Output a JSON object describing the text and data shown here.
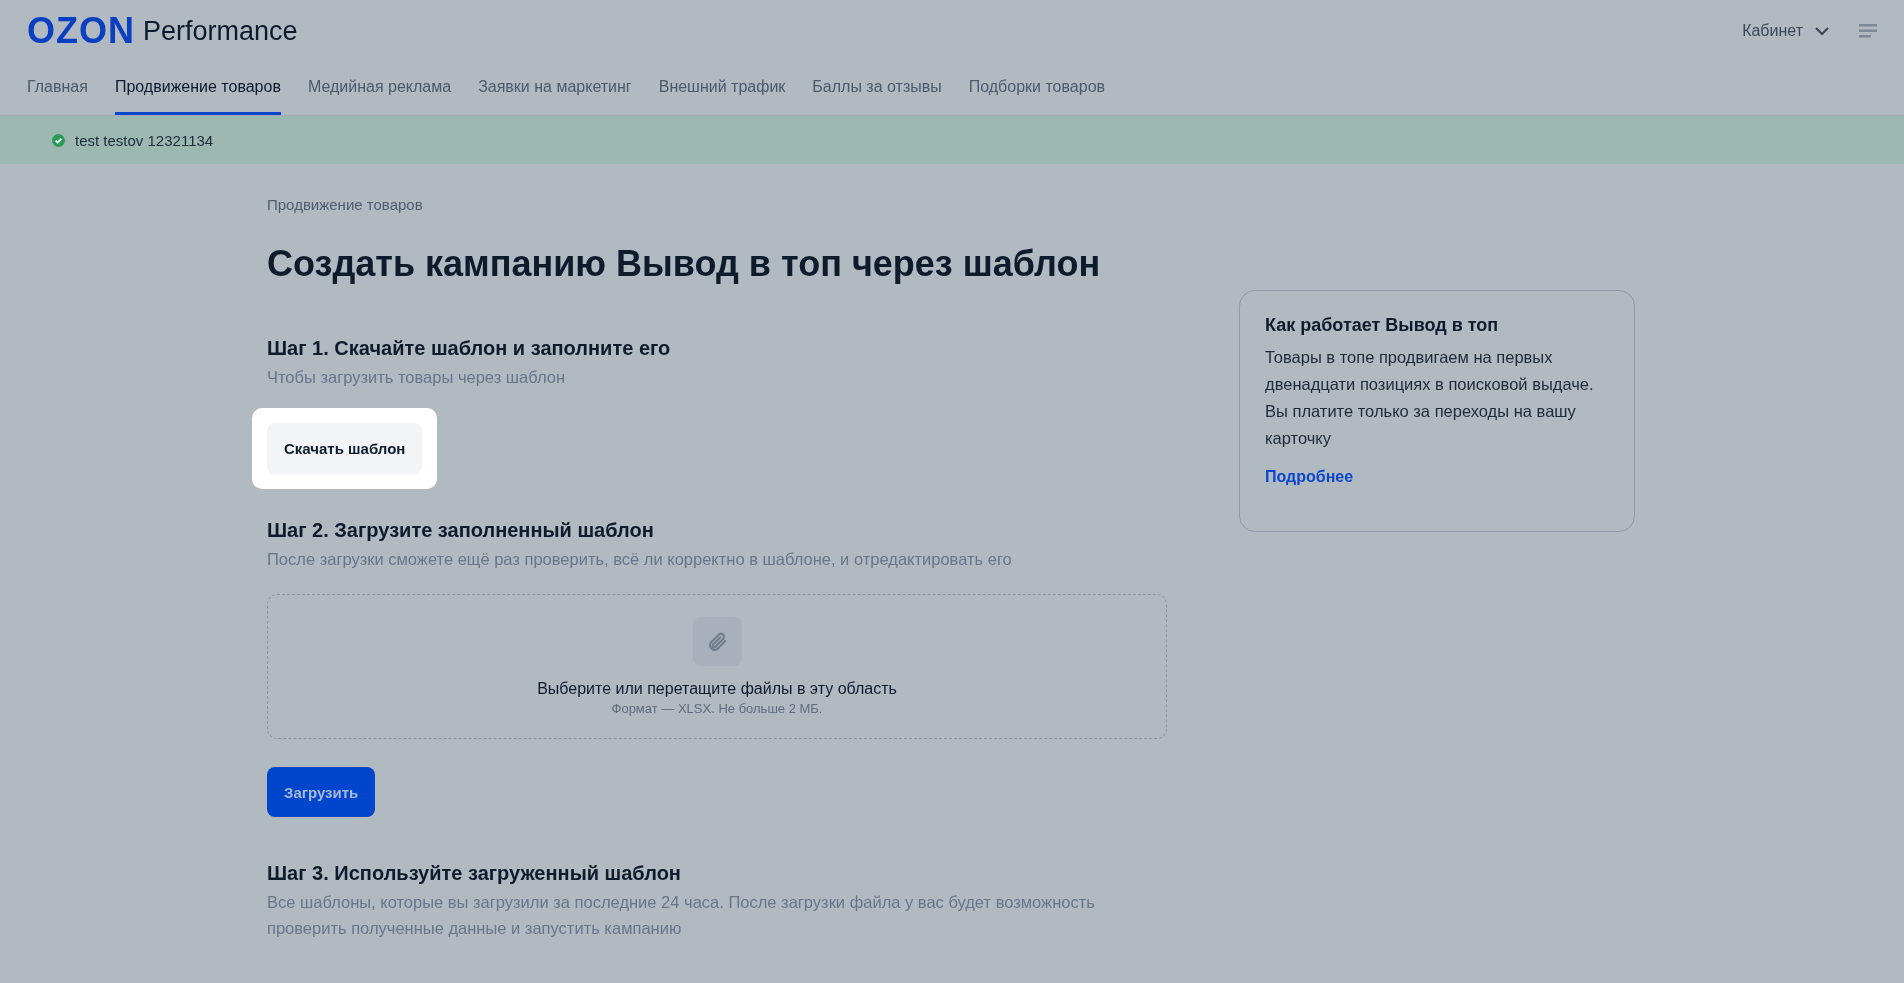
{
  "header": {
    "logo": "OZON",
    "product": "Performance",
    "account": "Кабинет"
  },
  "tabs": [
    {
      "label": "Главная",
      "selected": false
    },
    {
      "label": "Продвижение товаров",
      "selected": true
    },
    {
      "label": "Медийная реклама",
      "selected": false
    },
    {
      "label": "Заявки на маркетинг",
      "selected": false
    },
    {
      "label": "Внешний трафик",
      "selected": false
    },
    {
      "label": "Баллы за отзывы",
      "selected": false
    },
    {
      "label": "Подборки товаров",
      "selected": false
    }
  ],
  "status_bar": {
    "text": "test testov 12321134"
  },
  "breadcrumb": "Продвижение товаров",
  "title": "Создать кампанию Вывод в топ через шаблон",
  "steps": [
    {
      "kind": "download",
      "title": "Шаг 1. Скачайте шаблон и заполните его",
      "description": "Чтобы загрузить товары через шаблон",
      "button": {
        "label": "Скачать шаблон",
        "highlighted": true
      }
    },
    {
      "kind": "upload",
      "title": "Шаг 2. Загрузите заполненный шаблон",
      "description": "После загрузки сможете ещё раз проверить, всё ли корректно в шаблоне, и отредактировать его",
      "dropzone": {
        "text": "Выберите или перетащите файлы в эту область",
        "hint": "Формат — XLSX. Не больше 2 МБ."
      },
      "button": {
        "label": "Загрузить",
        "highlighted": false
      }
    },
    {
      "kind": "list",
      "title": "Шаг 3. Используйте загруженный шаблон",
      "description": "Все шаблоны, которые вы загрузили за последние 24 часа. После загрузки файла у вас будет возможность проверить полученные данные и запустить кампанию"
    }
  ],
  "info_card": {
    "title": "Как работает Вывод в топ",
    "text": "Товары в топе продвигаем на первых двенадцати позициях в поисковой выдаче. Вы платите только за переходы на вашу карточку",
    "link": "Подробнее"
  }
}
